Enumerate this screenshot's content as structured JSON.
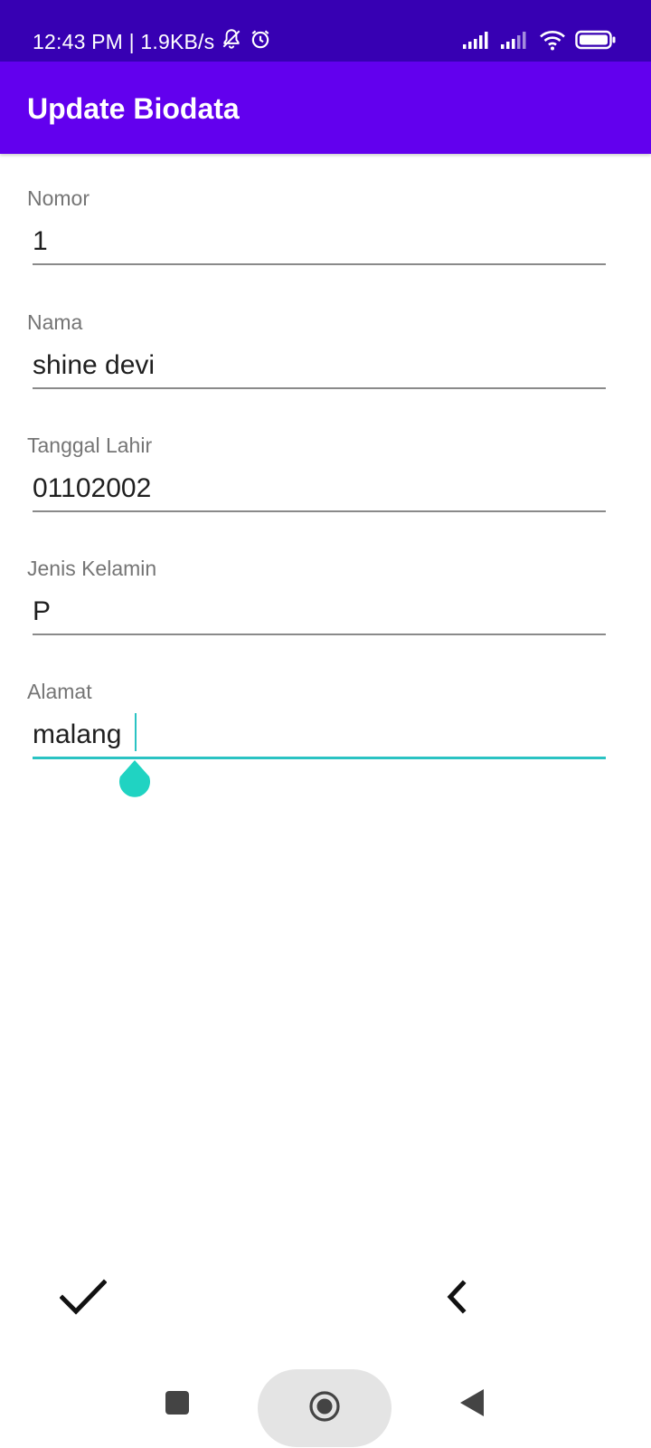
{
  "status_bar": {
    "time_speed": "12:43 PM | 1.9KB/s",
    "icons": [
      "notifications-muted-icon",
      "alarm-icon",
      "cell-signal-icon",
      "cell-signal-icon",
      "wifi-icon",
      "battery-icon"
    ],
    "background": "#3700B3"
  },
  "app_bar": {
    "title": "Update Biodata",
    "background": "#6200EE"
  },
  "form": {
    "fields": [
      {
        "label": "Nomor",
        "value": "1"
      },
      {
        "label": "Nama",
        "value": "shine devi"
      },
      {
        "label": "Tanggal Lahir",
        "value": "01102002"
      },
      {
        "label": "Jenis Kelamin",
        "value": "P"
      },
      {
        "label": "Alamat",
        "value": "malang",
        "focused": true
      }
    ],
    "accent_color": "#2AC3C3"
  },
  "actions": {
    "save_icon": "checkmark-icon",
    "back_icon": "chevron-left-icon"
  },
  "nav_bar": {
    "buttons": [
      "recents-icon",
      "home-icon",
      "back-icon"
    ]
  }
}
